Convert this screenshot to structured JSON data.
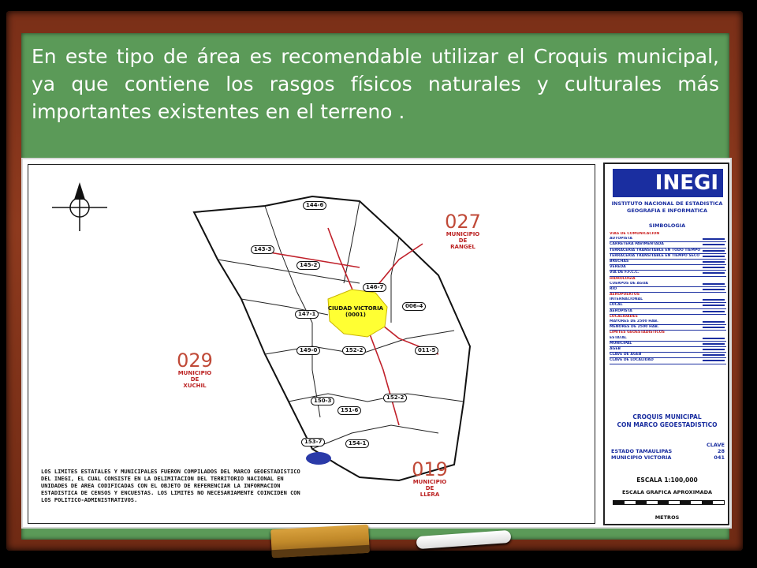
{
  "caption": "En este tipo de área es recomendable utilizar el Croquis municipal, ya que contiene los rasgos físicos naturales y culturales más importantes existentes en el terreno .",
  "map": {
    "neighbors": [
      {
        "code": "027",
        "line1": "MUNICIPIO",
        "line2": "DE",
        "line3": "RANGEL"
      },
      {
        "code": "029",
        "line1": "MUNICIPIO",
        "line2": "DE",
        "line3": "XUCHIL"
      },
      {
        "code": "019",
        "line1": "MUNICIPIO",
        "line2": "DE",
        "line3": "LLERA"
      }
    ],
    "city_label": "CIUDAD VICTORIA",
    "city_code": "(0001)",
    "agebs": [
      "144-6",
      "143-3",
      "145-2",
      "146-7",
      "147-1",
      "006-4",
      "152-2",
      "011-5",
      "149-0",
      "150-3",
      "151-6",
      "152-2",
      "153-7",
      "154-1"
    ],
    "note": "LOS LIMITES ESTATALES Y MUNICIPALES FUERON COMPILADOS DEL MARCO GEOESTADISTICO DEL INEGI, EL CUAL CONSISTE EN LA DELIMITACION DEL TERRITORIO NACIONAL EN UNIDADES DE AREA CODIFICADAS CON EL OBJETO DE REFERENCIAR LA INFORMACION ESTADISTICA DE CENSOS Y ENCUESTAS. LOS LIMITES NO NECESARIAMENTE COINCIDEN CON LOS POLITICO-ADMINISTRATIVOS."
  },
  "legend": {
    "logo": "INEGI",
    "institute_line1": "INSTITUTO NACIONAL DE ESTADISTICA",
    "institute_line2": "GEOGRAFIA E INFORMATICA",
    "simbologia": "SIMBOLOGIA",
    "rows": [
      {
        "text": "VIAS DE COMUNICACION",
        "head": true
      },
      {
        "text": "AUTOPISTA",
        "head": false
      },
      {
        "text": "CARRETERA PAVIMENTADA",
        "head": false
      },
      {
        "text": "TERRACERIA TRANSITABLE EN TODO TIEMPO",
        "head": false
      },
      {
        "text": "TERRACERIA TRANSITABLE EN TIEMPO SECO",
        "head": false
      },
      {
        "text": "BRECHAS",
        "head": false
      },
      {
        "text": "VEREDA",
        "head": false
      },
      {
        "text": "VIA DE F.F.C.C.",
        "head": false
      },
      {
        "text": "HIDROLOGIA",
        "head": true
      },
      {
        "text": "CUERPOS DE AGUA",
        "head": false
      },
      {
        "text": "RIO",
        "head": false
      },
      {
        "text": "AEROPUERTOS",
        "head": true
      },
      {
        "text": "INTERNACIONAL",
        "head": false
      },
      {
        "text": "LOCAL",
        "head": false
      },
      {
        "text": "AEROPISTA",
        "head": false
      },
      {
        "text": "LOCALIDADES",
        "head": true
      },
      {
        "text": "MAYORES DE 2500 HAB.",
        "head": false
      },
      {
        "text": "MENORES DE 2500 HAB.",
        "head": false
      },
      {
        "text": "LIMITES GEOESTADISTICOS",
        "head": true
      },
      {
        "text": "ESTATAL",
        "head": false
      },
      {
        "text": "MUNICIPAL",
        "head": false
      },
      {
        "text": "AGEB",
        "head": false
      },
      {
        "text": "CLAVE DE AGEB",
        "head": false
      },
      {
        "text": "CLAVE DE LOCALIDAD",
        "head": false
      }
    ],
    "croquis_line1": "CROQUIS MUNICIPAL",
    "croquis_line2": "CON MARCO GEOESTADISTICO",
    "clave_header": "CLAVE",
    "estado_label": "ESTADO TAMAULIPAS",
    "estado_value": "28",
    "municipio_label": "MUNICIPIO VICTORIA",
    "municipio_value": "041",
    "escala": "ESCALA 1:100,000",
    "escala_grafica": "ESCALA GRAFICA APROXIMADA",
    "metros": "METROS"
  },
  "colors": {
    "board": "#5b9a58",
    "frame": "#7a2f18",
    "city_fill": "#ffff33",
    "logo_blue": "#1a2ea0",
    "road_red": "#c0202a"
  }
}
